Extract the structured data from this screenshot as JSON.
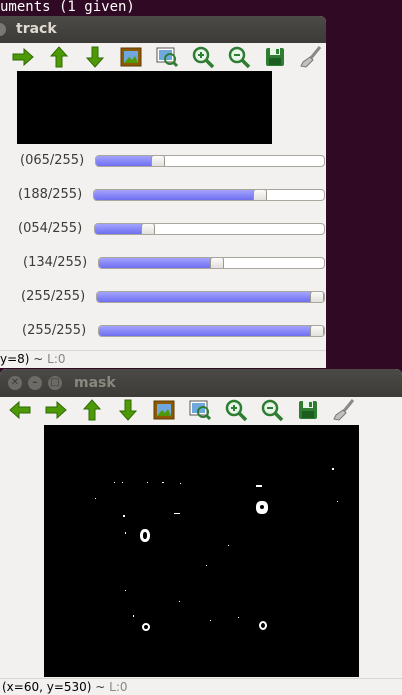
{
  "terminal": {
    "text": "uments (1 given)"
  },
  "track_window": {
    "title": "track",
    "status": {
      "position": "y=8)",
      "separator": " ~ ",
      "level": "L:0"
    },
    "sliders": [
      {
        "label": "(065/255)",
        "value": 65,
        "max": 255
      },
      {
        "label": "(188/255)",
        "value": 188,
        "max": 255
      },
      {
        "label": "(054/255)",
        "value": 54,
        "max": 255
      },
      {
        "label": "(134/255)",
        "value": 134,
        "max": 255
      },
      {
        "label": "(255/255)",
        "value": 255,
        "max": 255
      },
      {
        "label": "(255/255)",
        "value": 255,
        "max": 255
      }
    ]
  },
  "mask_window": {
    "title": "mask",
    "status": {
      "position": "(x=60, y=530)",
      "separator": " ~ ",
      "level": "L:0"
    }
  },
  "toolbar_icons": [
    "arrow-left-icon",
    "arrow-right-icon",
    "arrow-up-icon",
    "arrow-down-icon",
    "picture-icon",
    "zoom-region-icon",
    "zoom-in-icon",
    "zoom-out-icon",
    "save-icon",
    "properties-brush-icon"
  ],
  "colors": {
    "slider_fill": "#7777f4",
    "titlebar": "#3c3b37",
    "terminal_bg": "#300a24",
    "window_bg": "#f2f1f0"
  }
}
